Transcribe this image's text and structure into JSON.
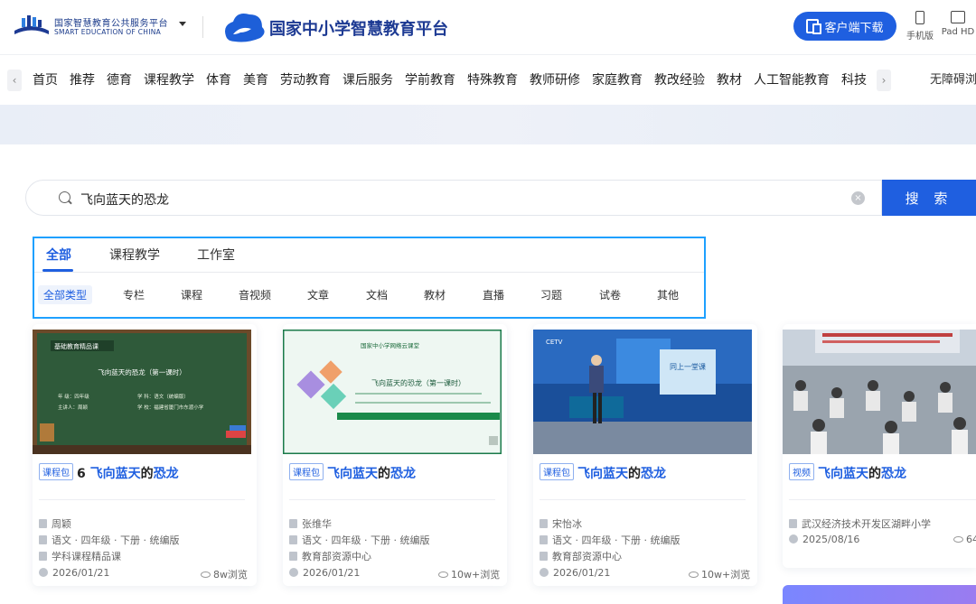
{
  "header": {
    "small_brand_cn": "国家智慧教育公共服务平台",
    "small_brand_en": "SMART EDUCATION OF CHINA",
    "main_title": "国家中小学智慧教育平台",
    "client_download": "客户端下载",
    "device_phone": "手机版",
    "device_pad": "Pad HD",
    "logo_icon": "smart-education-logo",
    "brand_color": "#1d3a93",
    "accent_color": "#1f5fe0"
  },
  "nav": {
    "items": [
      "首页",
      "推荐",
      "德育",
      "课程教学",
      "体育",
      "美育",
      "劳动教育",
      "课后服务",
      "学前教育",
      "特殊教育",
      "教师研修",
      "家庭教育",
      "教改经验",
      "教材",
      "人工智能教育",
      "科技"
    ],
    "accessibility": "无障碍浏",
    "left_arrow": "‹",
    "right_arrow": "›"
  },
  "search": {
    "query": "飞向蓝天的恐龙",
    "button": "搜 索",
    "clear_icon": "×"
  },
  "filters": {
    "tabs": [
      "全部",
      "课程教学",
      "工作室"
    ],
    "active_tab": "全部",
    "types": [
      "全部类型",
      "专栏",
      "课程",
      "音视频",
      "文章",
      "文档",
      "教材",
      "直播",
      "习题",
      "试卷",
      "其他"
    ],
    "active_type": "全部类型"
  },
  "cards": [
    {
      "badge": "课程包",
      "title_prefix": "6 ",
      "title_highlight": "飞向蓝天",
      "title_mid": "的",
      "title_highlight2": "恐龙",
      "author": "周颖",
      "subject": "语文 · 四年级 · 下册 · 统编版",
      "source": "学科课程精品课",
      "date": "2026/01/21",
      "views": "8w浏览",
      "thumb": {
        "heading": "基础教育精品课",
        "title": "飞向蓝天的恐龙（第一课时）",
        "row1_left": "年  级：四年级",
        "row1_right": "学  科：语文（统编版）",
        "row2_left": "主讲人：周颖",
        "row2_right": "学  校：福建省厦门市东渡小学"
      }
    },
    {
      "badge": "课程包",
      "title_prefix": "",
      "title_highlight": "飞向蓝天",
      "title_mid": "的",
      "title_highlight2": "恐龙",
      "author": "张维华",
      "subject": "语文 · 四年级 · 下册 · 统编版",
      "source": "教育部资源中心",
      "date": "2026/01/21",
      "views": "10w+浏览",
      "thumb": {
        "heading": "国家中小学网络云课堂",
        "title": "飞向蓝天的恐龙（第一课时）"
      }
    },
    {
      "badge": "课程包",
      "title_prefix": "",
      "title_highlight": "飞向蓝天",
      "title_mid": "的",
      "title_highlight2": "恐龙",
      "author": "宋怡冰",
      "subject": "语文 · 四年级 · 下册 · 统编版",
      "source": "教育部资源中心",
      "date": "2026/01/21",
      "views": "10w+浏览",
      "thumb": {
        "channel": "CETV",
        "screen_text": "同上一堂课"
      }
    },
    {
      "badge": "视频",
      "title_prefix": "",
      "title_highlight": "飞向蓝天",
      "title_mid": "的",
      "title_highlight2": "恐龙",
      "author": "武汉经济技术开发区湖畔小学",
      "date": "2025/08/16",
      "views": "64"
    }
  ]
}
